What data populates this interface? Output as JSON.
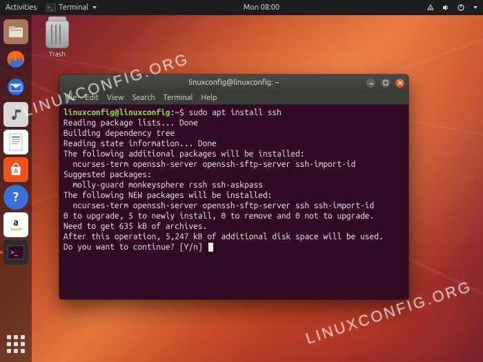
{
  "topbar": {
    "activities": "Activities",
    "app_label": "Terminal",
    "clock": "Mon 08:00"
  },
  "desktop": {
    "trash_label": "Trash"
  },
  "dock": {
    "items": [
      {
        "name": "nautilus",
        "bg": "#8a5a3a",
        "glyph": "📁"
      },
      {
        "name": "firefox",
        "bg": "transparent",
        "glyph": "🦊"
      },
      {
        "name": "thunderbird",
        "bg": "transparent",
        "glyph": "✉"
      },
      {
        "name": "rhythmbox",
        "bg": "#c9c9c9",
        "glyph": "🎵"
      },
      {
        "name": "libreoffice-writer",
        "bg": "#ffffff",
        "glyph": "📄"
      },
      {
        "name": "ubuntu-software",
        "bg": "#e95420",
        "glyph": "A"
      },
      {
        "name": "help",
        "bg": "#3a6fd8",
        "glyph": "?"
      },
      {
        "name": "amazon",
        "bg": "#ffffff",
        "glyph": "a"
      },
      {
        "name": "terminal",
        "bg": "#2c2c2c",
        "glyph": ">_",
        "active": true
      }
    ]
  },
  "window": {
    "title": "linuxconfig@linuxconfig: ~",
    "menus": [
      "File",
      "Edit",
      "View",
      "Search",
      "Terminal",
      "Help"
    ]
  },
  "terminal": {
    "prompt_user": "linuxconfig@linuxconfig",
    "prompt_path": "~",
    "prompt_symbol": "$",
    "command": "sudo apt install ssh",
    "lines": [
      "Reading package lists... Done",
      "Building dependency tree",
      "Reading state information... Done",
      "The following additional packages will be installed:",
      "  ncurses-term openssh-server openssh-sftp-server ssh-import-id",
      "Suggested packages:",
      "  molly-guard monkeysphere rssh ssh-askpass",
      "The following NEW packages will be installed:",
      "  ncurses-term openssh-server openssh-sftp-server ssh ssh-import-id",
      "0 to upgrade, 5 to newly install, 0 to remove and 0 not to upgrade.",
      "Need to get 635 kB of archives.",
      "After this operation, 5,247 kB of additional disk space will be used.",
      "Do you want to continue? [Y/n] "
    ]
  },
  "watermark": "LINUXCONFIG.ORG"
}
